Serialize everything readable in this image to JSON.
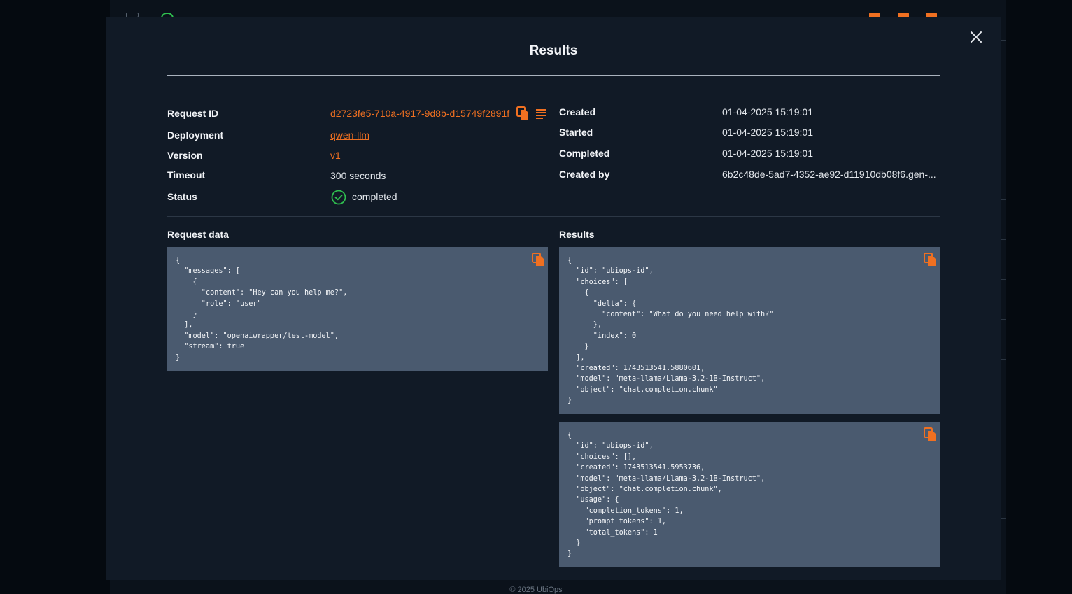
{
  "modal": {
    "title": "Results",
    "close_icon": "close-icon"
  },
  "details": {
    "left": [
      {
        "label": "Request ID",
        "value": "d2723fe5-710a-4917-9d8b-d15749f2891f",
        "link": true
      },
      {
        "label": "Deployment",
        "value": "qwen-llm",
        "link": true
      },
      {
        "label": "Version",
        "value": "v1",
        "link": true
      },
      {
        "label": "Timeout",
        "value": "300 seconds",
        "link": false
      },
      {
        "label": "Status",
        "value": "completed",
        "link": false
      }
    ],
    "right": [
      {
        "label": "Created",
        "value": "01-04-2025 15:19:01"
      },
      {
        "label": "Started",
        "value": "01-04-2025 15:19:01"
      },
      {
        "label": "Completed",
        "value": "01-04-2025 15:19:01"
      },
      {
        "label": "Created by",
        "value": "6b2c48de-5ad7-4352-ae92-d11910db08f6.gen-..."
      }
    ]
  },
  "sections": {
    "request_data_label": "Request data",
    "results_label": "Results"
  },
  "request_data": "{\n  \"messages\": [\n    {\n      \"content\": \"Hey can you help me?\",\n      \"role\": \"user\"\n    }\n  ],\n  \"model\": \"openaiwrapper/test-model\",\n  \"stream\": true\n}",
  "results": [
    "{\n  \"id\": \"ubiops-id\",\n  \"choices\": [\n    {\n      \"delta\": {\n        \"content\": \"What do you need help with?\"\n      },\n      \"index\": 0\n    }\n  ],\n  \"created\": 1743513541.5880601,\n  \"model\": \"meta-llama/Llama-3.2-1B-Instruct\",\n  \"object\": \"chat.completion.chunk\"\n}",
    "{\n  \"id\": \"ubiops-id\",\n  \"choices\": [],\n  \"created\": 1743513541.5953736,\n  \"model\": \"meta-llama/Llama-3.2-1B-Instruct\",\n  \"object\": \"chat.completion.chunk\",\n  \"usage\": {\n    \"completion_tokens\": 1,\n    \"prompt_tokens\": 1,\n    \"total_tokens\": 1\n  }\n}"
  ],
  "footer": "© 2025 UbiOps",
  "colors": {
    "accent": "#f07021",
    "success": "#2fbf4f",
    "code_bg": "#4a5a6f",
    "modal_bg": "#111a26"
  }
}
